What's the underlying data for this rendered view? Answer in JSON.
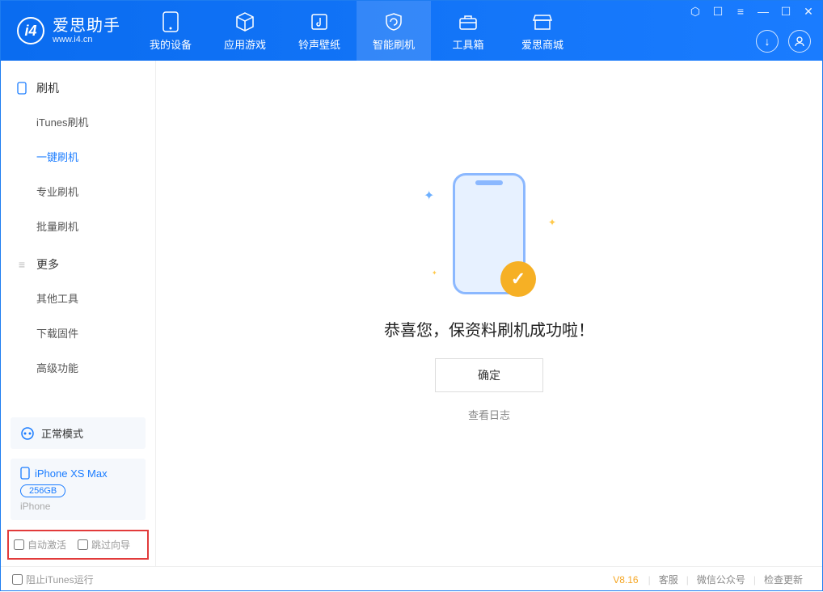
{
  "header": {
    "logo_cn": "爱思助手",
    "logo_en": "www.i4.cn",
    "nav": [
      {
        "label": "我的设备"
      },
      {
        "label": "应用游戏"
      },
      {
        "label": "铃声壁纸"
      },
      {
        "label": "智能刷机"
      },
      {
        "label": "工具箱"
      },
      {
        "label": "爱思商城"
      }
    ]
  },
  "sidebar": {
    "section1_title": "刷机",
    "items1": [
      {
        "label": "iTunes刷机"
      },
      {
        "label": "一键刷机"
      },
      {
        "label": "专业刷机"
      },
      {
        "label": "批量刷机"
      }
    ],
    "section2_title": "更多",
    "items2": [
      {
        "label": "其他工具"
      },
      {
        "label": "下载固件"
      },
      {
        "label": "高级功能"
      }
    ],
    "status": "正常模式",
    "device_name": "iPhone XS Max",
    "device_storage": "256GB",
    "device_type": "iPhone",
    "opt1": "自动激活",
    "opt2": "跳过向导"
  },
  "main": {
    "message": "恭喜您，保资料刷机成功啦！",
    "ok": "确定",
    "log": "查看日志"
  },
  "footer": {
    "block_itunes": "阻止iTunes运行",
    "version": "V8.16",
    "link1": "客服",
    "link2": "微信公众号",
    "link3": "检查更新"
  }
}
